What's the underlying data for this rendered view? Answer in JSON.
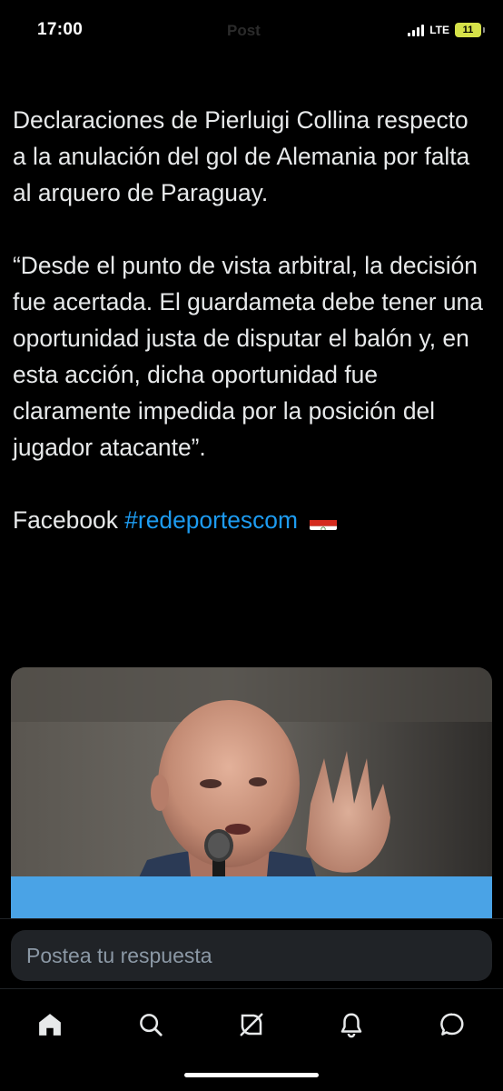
{
  "status_bar": {
    "time": "17:00",
    "ghost_title": "Post",
    "network": "LTE",
    "battery": "11",
    "battery_color": "#d6e249"
  },
  "tweet": {
    "paragraph_1": "Declaraciones de Pierluigi Collina respecto a la anulación del gol de Alemania por falta al arquero de Paraguay.",
    "paragraph_2": "“Desde el punto de vista arbitral, la decisión fue acertada. El guardameta debe tener una oportunidad justa de disputar el balón y, en esta acción, dicha oportunidad fue claramente impedida por la posición del jugador atacante”.",
    "source_label": "Facebook",
    "hashtag": "#redeportescom",
    "flag_icon": "paraguay-flag-icon",
    "hashtag_color": "#1d9bf0"
  },
  "media": {
    "image_icon": "referee-photo-image"
  },
  "reply": {
    "placeholder": "Postea tu respuesta"
  },
  "nav": {
    "items": [
      {
        "icon": "home-icon",
        "active": true
      },
      {
        "icon": "search-icon",
        "active": false
      },
      {
        "icon": "grok-icon",
        "active": false
      },
      {
        "icon": "notifications-icon",
        "active": false
      },
      {
        "icon": "messages-icon",
        "active": false
      }
    ]
  },
  "colors": {
    "background": "#000000",
    "text": "#e7e9ea",
    "muted": "#8b98a5",
    "input_bg": "#202327"
  }
}
